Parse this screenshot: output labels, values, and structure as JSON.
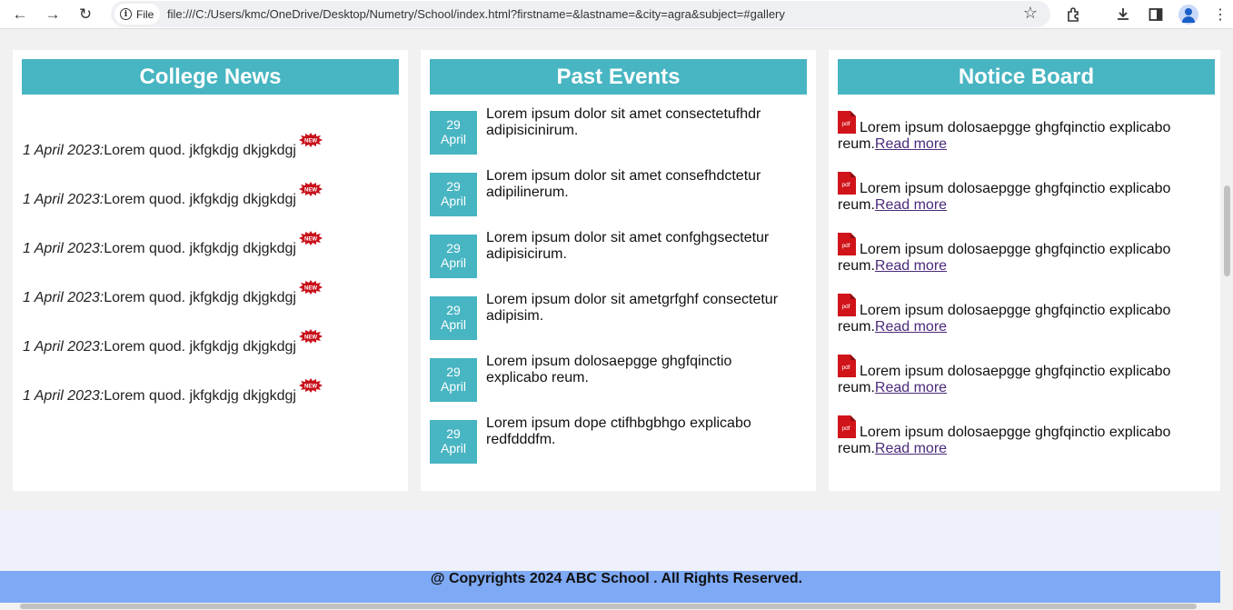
{
  "browser": {
    "file_label": "File",
    "url": "file:///C:/Users/kmc/OneDrive/Desktop/Numetry/School/index.html?firstname=&lastname=&city=agra&subject=#gallery"
  },
  "college_news": {
    "title": "College News",
    "items": [
      {
        "date": "1 April 2023:",
        "text": "Lorem quod. jkfgkdjg dkjgkdgj",
        "badge": "NEW"
      },
      {
        "date": "1 April 2023:",
        "text": "Lorem quod. jkfgkdjg dkjgkdgj",
        "badge": "NEW"
      },
      {
        "date": "1 April 2023:",
        "text": "Lorem quod. jkfgkdjg dkjgkdgj",
        "badge": "NEW"
      },
      {
        "date": "1 April 2023:",
        "text": "Lorem quod. jkfgkdjg dkjgkdgj",
        "badge": "NEW"
      },
      {
        "date": "1 April 2023:",
        "text": "Lorem quod. jkfgkdjg dkjgkdgj",
        "badge": "NEW"
      },
      {
        "date": "1 April 2023:",
        "text": "Lorem quod. jkfgkdjg dkjgkdgj",
        "badge": "NEW"
      }
    ]
  },
  "past_events": {
    "title": "Past Events",
    "items": [
      {
        "day": "29",
        "month": "April",
        "text": "Lorem ipsum dolor sit amet consectetufhdr adipisicinirum."
      },
      {
        "day": "29",
        "month": "April",
        "text": "Lorem ipsum dolor sit amet consefhdctetur adipilinerum."
      },
      {
        "day": "29",
        "month": "April",
        "text": "Lorem ipsum dolor sit amet confghgsectetur adipisicirum."
      },
      {
        "day": "29",
        "month": "April",
        "text": "Lorem ipsum dolor sit ametgrfghf consectetur adipisim."
      },
      {
        "day": "29",
        "month": "April",
        "text": "Lorem ipsum dolosaepgge ghgfqinctio explicabo reum."
      },
      {
        "day": "29",
        "month": "April",
        "text": "Lorem ipsum dope ctifhbgbhgo explicabo redfdddfm."
      }
    ]
  },
  "notice_board": {
    "title": "Notice Board",
    "items": [
      {
        "icon_label": "pdf",
        "text": "Lorem ipsum dolosaepgge ghgfqinctio explicabo reum.",
        "link": "Read more"
      },
      {
        "icon_label": "pdf",
        "text": "Lorem ipsum dolosaepgge ghgfqinctio explicabo reum.",
        "link": "Read more"
      },
      {
        "icon_label": "pdf",
        "text": "Lorem ipsum dolosaepgge ghgfqinctio explicabo reum.",
        "link": "Read more"
      },
      {
        "icon_label": "pdf",
        "text": "Lorem ipsum dolosaepgge ghgfqinctio explicabo reum.",
        "link": "Read more"
      },
      {
        "icon_label": "pdf",
        "text": "Lorem ipsum dolosaepgge ghgfqinctio explicabo reum.",
        "link": "Read more"
      },
      {
        "icon_label": "pdf",
        "text": "Lorem ipsum dolosaepgge ghgfqinctio explicabo reum.",
        "link": "Read more"
      }
    ]
  },
  "footer": {
    "text": "@ Copyrights 2024 ABC School . All Rights Reserved."
  },
  "colors": {
    "header_teal": "#48b5c2",
    "footer_blue": "#7ea9f5",
    "link_purple": "#4b2a7a",
    "pdf_red": "#d0141a"
  }
}
